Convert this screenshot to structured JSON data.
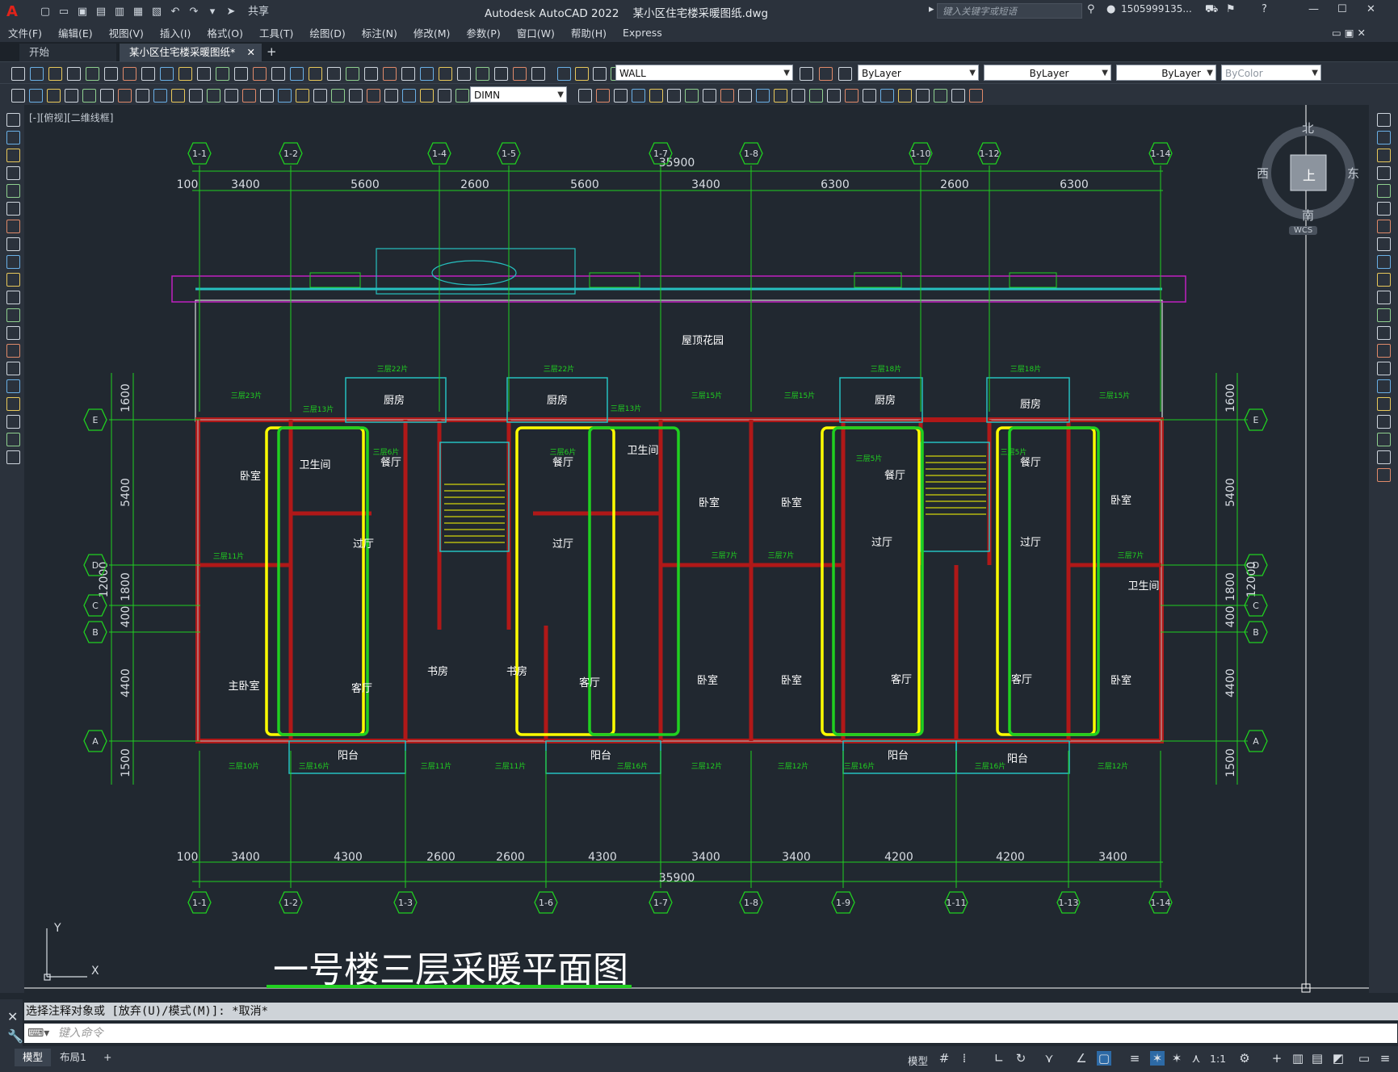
{
  "app": {
    "title": "Autodesk AutoCAD 2022",
    "document": "某小区住宅楼采暖图纸.dwg",
    "logo": "A",
    "share_label": "共享",
    "search_placeholder": "键入关键字或短语",
    "user": "1505999135..."
  },
  "menu": [
    "文件(F)",
    "编辑(E)",
    "视图(V)",
    "插入(I)",
    "格式(O)",
    "工具(T)",
    "绘图(D)",
    "标注(N)",
    "修改(M)",
    "参数(P)",
    "窗口(W)",
    "帮助(H)",
    "Express"
  ],
  "tabs": [
    {
      "label": "开始",
      "active": false
    },
    {
      "label": "某小区住宅楼采暖图纸*",
      "active": true
    }
  ],
  "toolbar": {
    "layer_value": "WALL",
    "color_value": "ByLayer",
    "linetype_value": "ByLayer",
    "lineweight_value": "ByLayer",
    "plotstyle_value": "ByColor",
    "dimstyle_value": "DIMN"
  },
  "viewport_label": "[-][俯视][二维线框]",
  "viewcube": {
    "north": "北",
    "south": "南",
    "east": "东",
    "west": "西",
    "top": "上",
    "wcs": "WCS"
  },
  "drawing": {
    "title": "一号楼三层采暖平面图",
    "total_dim": "35900",
    "top_dims": [
      "100",
      "3400",
      "5600",
      "2600",
      "5600",
      "3400",
      "6300",
      "2600",
      "6300"
    ],
    "bottom_dims": [
      "100",
      "3400",
      "4300",
      "2600",
      "2600",
      "4300",
      "3400",
      "3400",
      "4200",
      "4200",
      "3400"
    ],
    "top_axes": [
      "1-1",
      "1-2",
      "1-4",
      "1-5",
      "1-7",
      "1-8",
      "1-10",
      "1-12",
      "1-14"
    ],
    "bottom_axes": [
      "1-1",
      "1-2",
      "1-3",
      "1-6",
      "1-7",
      "1-8",
      "1-9",
      "1-11",
      "1-13",
      "1-14"
    ],
    "row_axes": [
      "E",
      "D",
      "C",
      "B",
      "A"
    ],
    "side_dims": [
      "1600",
      "5400",
      "1800",
      "400",
      "4400",
      "1500"
    ],
    "side_total": "12000",
    "rooms": {
      "garden": "屋顶花园",
      "bedroom": "卧室",
      "master_bedroom": "主卧室",
      "kitchen": "厨房",
      "bathroom": "卫生间",
      "dining": "餐厅",
      "hall": "过厅",
      "living": "客厅",
      "study": "书房",
      "balcony": "阳台"
    },
    "radiators": [
      "三层22片",
      "三层23片",
      "三层13片",
      "三层6片",
      "三层15片",
      "三层18片",
      "三层5片",
      "三层11片",
      "三层7片",
      "三层10片",
      "三层16片",
      "三层12片"
    ]
  },
  "command": {
    "history": "选择注释对象或 [放弃(U)/模式(M)]: *取消*",
    "placeholder": "键入命令"
  },
  "status": {
    "model_tab": "模型",
    "layout_tab": "布局1",
    "model_label": "模型",
    "scale": "1:1"
  }
}
